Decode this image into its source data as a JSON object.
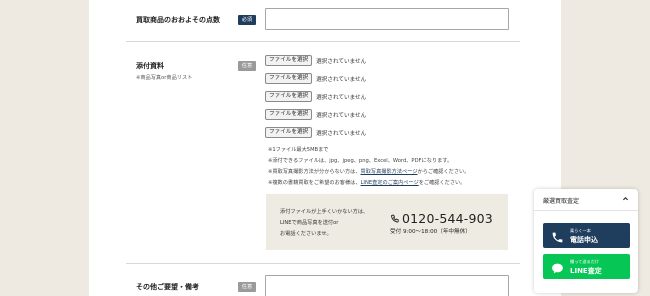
{
  "form": {
    "count_field": {
      "label": "買取商品のおおよその点数",
      "badge": "必須"
    },
    "attachment": {
      "label": "添付資料",
      "sublabel": "※商品写真or商品リスト",
      "badge": "任意",
      "file_inputs": [
        {
          "button": "ファイルを選択",
          "status": "選択されていません"
        },
        {
          "button": "ファイルを選択",
          "status": "選択されていません"
        },
        {
          "button": "ファイルを選択",
          "status": "選択されていません"
        },
        {
          "button": "ファイルを選択",
          "status": "選択されていません"
        },
        {
          "button": "ファイルを選択",
          "status": "選択されていません"
        }
      ],
      "notes": {
        "n1": "※1ファイル最大5MBまで",
        "n2": "※添付できるファイルは、jpg、jpeg、png、Excel、Word、PDFになります。",
        "n3_pre": "※買取写真撮影方法が分からない方は、",
        "n3_link": "買取写真撮影方法ページ",
        "n3_post": "からご確認ください。",
        "n4_pre": "※複数の書籍買取をご希望のお客様は、",
        "n4_link": "LINE査定のご案内ページ",
        "n4_post": "をご確認ください。"
      }
    },
    "contact_box": {
      "line1": "添付ファイルが上手くいかない方は、",
      "line2": "LINEで商品写真を送付or",
      "line3": "お電話くださいませ。",
      "phone": "0120-544-903",
      "hours": "受付 9:00～18:00（年中無休）"
    },
    "remarks_field": {
      "label": "その他ご要望・備考",
      "badge": "任意"
    }
  },
  "widget": {
    "title": "厳選買取査定",
    "phone_button": {
      "small": "楽らく一本",
      "label": "電話申込"
    },
    "line_button": {
      "small": "撮って送るだけ",
      "label": "LINE査定"
    }
  },
  "colors": {
    "navy": "#1f3e5e",
    "line_green": "#06c755",
    "background": "#eeeae1",
    "contact_box": "#eeebe2"
  },
  "icons": {
    "phone": "phone-icon",
    "chevron": "chevron-up-icon",
    "chat": "chat-bubble-icon"
  }
}
